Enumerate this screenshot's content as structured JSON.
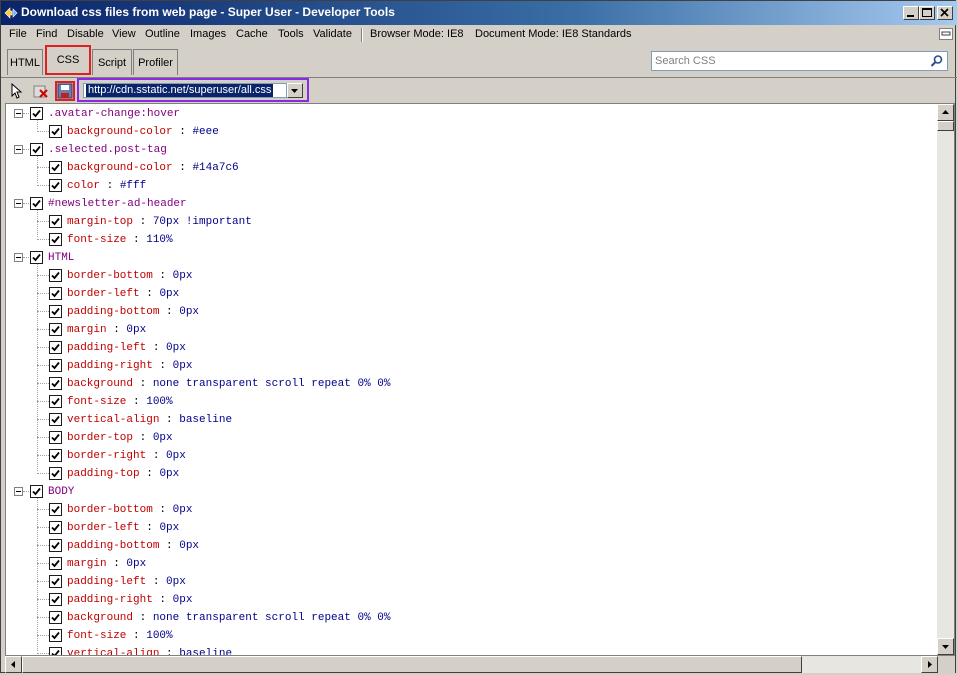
{
  "window": {
    "title": "Download css files from web page - Super User - Developer Tools",
    "icon": "ie-devtools-icon",
    "controls": [
      "minimize",
      "maximize",
      "close"
    ]
  },
  "menu": {
    "items": [
      "File",
      "Find",
      "Disable",
      "View",
      "Outline",
      "Images",
      "Cache",
      "Tools",
      "Validate"
    ],
    "browser_mode": "Browser Mode: IE8",
    "document_mode": "Document Mode: IE8 Standards"
  },
  "tabs": [
    {
      "label": "HTML",
      "active": false
    },
    {
      "label": "CSS",
      "active": true
    },
    {
      "label": "Script",
      "active": false
    },
    {
      "label": "Profiler",
      "active": false
    }
  ],
  "search": {
    "placeholder": "Search CSS",
    "value": ""
  },
  "toolbar": {
    "url": "http://cdn.sstatic.net/superuser/all.css",
    "buttons": [
      "select-element-icon",
      "clear-icon",
      "save-icon"
    ]
  },
  "css_tree": [
    {
      "selector": ".avatar-change:hover",
      "props": [
        [
          "background-color",
          "#eee"
        ]
      ]
    },
    {
      "selector": ".selected.post-tag",
      "props": [
        [
          "background-color",
          "#14a7c6"
        ],
        [
          "color",
          "#fff"
        ]
      ]
    },
    {
      "selector": "#newsletter-ad-header",
      "props": [
        [
          "margin-top",
          "70px !important"
        ],
        [
          "font-size",
          "110%"
        ]
      ]
    },
    {
      "selector": "HTML",
      "props": [
        [
          "border-bottom",
          "0px"
        ],
        [
          "border-left",
          "0px"
        ],
        [
          "padding-bottom",
          "0px"
        ],
        [
          "margin",
          "0px"
        ],
        [
          "padding-left",
          "0px"
        ],
        [
          "padding-right",
          "0px"
        ],
        [
          "background",
          "none transparent scroll repeat 0% 0%"
        ],
        [
          "font-size",
          "100%"
        ],
        [
          "vertical-align",
          "baseline"
        ],
        [
          "border-top",
          "0px"
        ],
        [
          "border-right",
          "0px"
        ],
        [
          "padding-top",
          "0px"
        ]
      ]
    },
    {
      "selector": "BODY",
      "props": [
        [
          "border-bottom",
          "0px"
        ],
        [
          "border-left",
          "0px"
        ],
        [
          "padding-bottom",
          "0px"
        ],
        [
          "margin",
          "0px"
        ],
        [
          "padding-left",
          "0px"
        ],
        [
          "padding-right",
          "0px"
        ],
        [
          "background",
          "none transparent scroll repeat 0% 0%"
        ],
        [
          "font-size",
          "100%"
        ],
        [
          "vertical-align",
          "baseline"
        ]
      ]
    }
  ],
  "colors": {
    "selector": "#800080",
    "property": "#c00000",
    "value": "#00008b",
    "highlight_red": "#e02020",
    "highlight_purple": "#8a2be2"
  }
}
